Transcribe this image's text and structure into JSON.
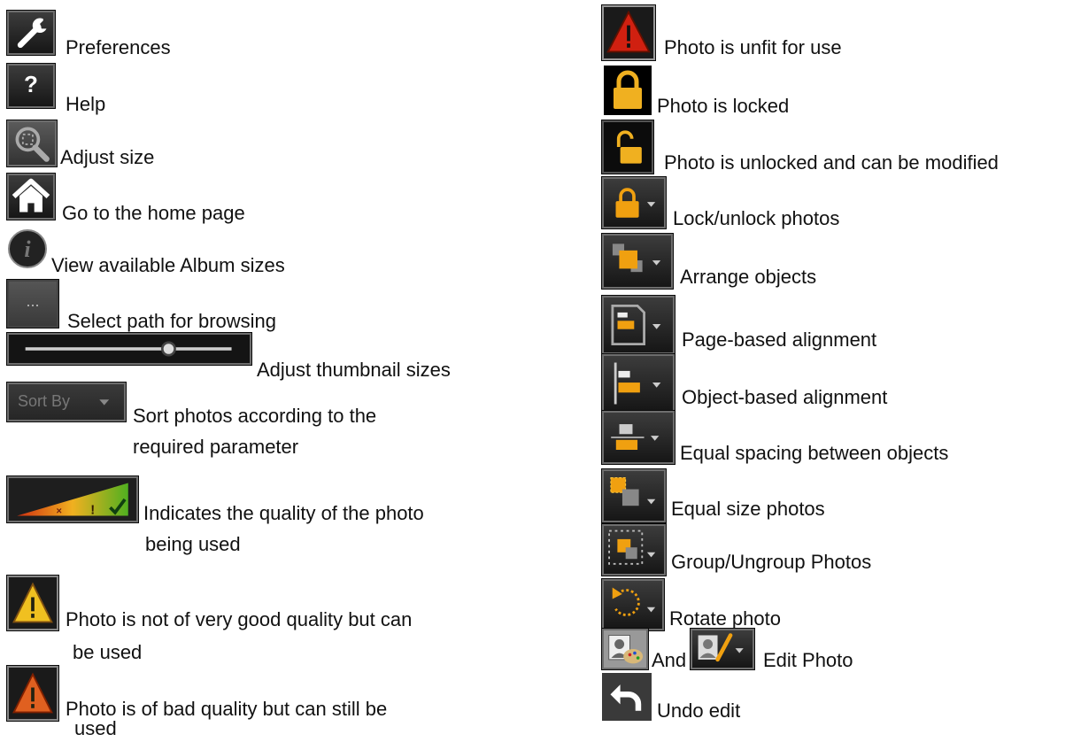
{
  "left": {
    "preferences": "Preferences",
    "help": "Help",
    "help_glyph": "?",
    "adjust_size": "Adjust size",
    "home": "Go to the home page",
    "album_sizes": "View available Album sizes",
    "browse_path": "Select path for browsing",
    "browse_glyph": "...",
    "thumb_sizes": "Adjust thumbnail sizes",
    "sort_glyph": "Sort By",
    "sort_line1": "Sort photos according to the",
    "sort_line2": "required parameter",
    "quality_line1": "Indicates the quality of the photo",
    "quality_line2": "being used",
    "not_good_line1": "Photo is not of very good quality but can",
    "not_good_line2": "be used",
    "bad_line1": "Photo is of bad quality but can still be",
    "bad_line2": "used"
  },
  "right": {
    "unfit": "Photo is unfit for use",
    "locked": "Photo is locked",
    "unlocked": "Photo is unlocked and can be modified",
    "lock_unlock": "Lock/unlock photos",
    "arrange": "Arrange objects",
    "page_align": "Page-based alignment",
    "object_align": "Object-based alignment",
    "equal_spacing": "Equal spacing between objects",
    "equal_size": "Equal size photos",
    "group": "Group/Ungroup Photos",
    "rotate": "Rotate photo",
    "and_word": "And",
    "edit_photo": "Edit Photo",
    "undo": "Undo edit"
  },
  "colors": {
    "orange": "#f0a010",
    "warning_yellow": "#f0c020",
    "warning_red": "#d03010",
    "quality_green": "#50b020"
  }
}
